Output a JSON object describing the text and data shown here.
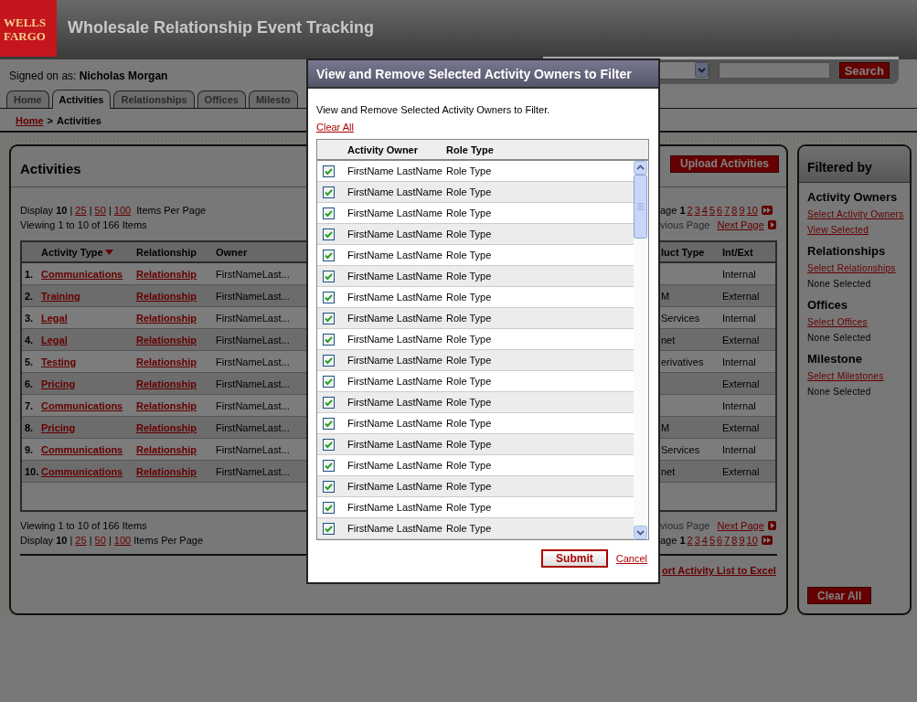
{
  "header": {
    "logo": "WELLS FARGO",
    "title": "Wholesale Relationship Event Tracking"
  },
  "search": {
    "button": "Search"
  },
  "user": {
    "label": "Signed on as:",
    "name": "Nicholas Morgan"
  },
  "tabs": [
    {
      "label": "Home",
      "selected": false
    },
    {
      "label": "Activities",
      "selected": true
    },
    {
      "label": "Relationships",
      "selected": false
    },
    {
      "label": "Offices",
      "selected": false
    },
    {
      "label": "Milesto",
      "selected": false
    }
  ],
  "breadcrumb": {
    "link": "Home",
    "separator": ">",
    "current": "Activities"
  },
  "activities": {
    "title": "Activities",
    "upload_button": "Upload Activities",
    "top_bar": {
      "display": {
        "label": "Display",
        "current": "10",
        "separator": "|",
        "options": [
          "25",
          "50",
          "100"
        ],
        "suffix": "Items Per Page"
      },
      "viewing": "Viewing 1 to 10 of 166 Items",
      "pager": {
        "label": "age",
        "current": "1",
        "pages": [
          "2",
          "3",
          "4",
          "5",
          "6",
          "7",
          "8",
          "9",
          "10"
        ],
        "previous": "vious Page",
        "next": "Next Page"
      }
    },
    "columns": [
      {
        "label": "Activity Type",
        "sorted": true
      },
      {
        "label": "Relationship",
        "sorted": false
      },
      {
        "label": "Owner",
        "sorted": false
      },
      {
        "label": "luct Type",
        "sorted": false
      },
      {
        "label": "Int/Ext",
        "sorted": false
      }
    ],
    "rows": [
      {
        "number": "1.",
        "activity_type": "Communications",
        "relationship": "Relationship",
        "owner": "FirstNameLast...",
        "int_ext": "Internal"
      },
      {
        "number": "2.",
        "activity_type": "Training",
        "relationship": "Relationship",
        "owner": "FirstNameLast...",
        "product_type": "M",
        "int_ext": "External"
      },
      {
        "number": "3.",
        "activity_type": "Legal",
        "relationship": "Relationship",
        "owner": "FirstNameLast...",
        "product_type": "Services",
        "int_ext": "Internal"
      },
      {
        "number": "4.",
        "activity_type": "Legal",
        "relationship": "Relationship",
        "owner": "FirstNameLast...",
        "product_type": "net",
        "int_ext": "External"
      },
      {
        "number": "5.",
        "activity_type": "Testing",
        "relationship": "Relationship",
        "owner": "FirstNameLast...",
        "product_type": "erivatives",
        "int_ext": "Internal"
      },
      {
        "number": "6.",
        "activity_type": "Pricing",
        "relationship": "Relationship",
        "owner": "FirstNameLast...",
        "int_ext": "External"
      },
      {
        "number": "7.",
        "activity_type": "Communications",
        "relationship": "Relationship",
        "owner": "FirstNameLast...",
        "int_ext": "Internal"
      },
      {
        "number": "8.",
        "activity_type": "Pricing",
        "relationship": "Relationship",
        "owner": "FirstNameLast...",
        "product_type": "M",
        "int_ext": "External"
      },
      {
        "number": "9.",
        "activity_type": "Communications",
        "relationship": "Relationship",
        "owner": "FirstNameLast...",
        "product_type": "Services",
        "int_ext": "Internal"
      },
      {
        "number": "10.",
        "activity_type": "Communications",
        "relationship": "Relationship",
        "owner": "FirstNameLast...",
        "product_type": "net",
        "int_ext": "External"
      }
    ],
    "bottom_bar": {
      "display": {
        "label": "Display",
        "current": "10",
        "separator": "|",
        "options": [
          "25",
          "50",
          "100"
        ],
        "suffix": "Items Per Page"
      },
      "viewing": "Viewing 1 to 10 of 166 Items",
      "pager": {
        "label": "age",
        "current": "1",
        "pages": [
          "2",
          "3",
          "4",
          "5",
          "6",
          "7",
          "8",
          "9",
          "10"
        ],
        "previous": "vious Page",
        "next": "Next Page"
      }
    },
    "export_link": "ort Activity List to Excel"
  },
  "filters": {
    "title": "Filtered by",
    "sections": [
      {
        "heading": "Activity Owners",
        "links": [
          "Select Activity Owners",
          "View Selected"
        ]
      },
      {
        "heading": "Relationships",
        "links": [
          "Select Relationships"
        ],
        "status": "None Selected"
      },
      {
        "heading": "Offices",
        "links": [
          "Select Offices"
        ],
        "status": "None Selected"
      },
      {
        "heading": "Milestone",
        "links": [
          "Select Milestones"
        ],
        "status": "None Selected"
      }
    ],
    "clear_button": "Clear All"
  },
  "dialog": {
    "title": "View and Remove Selected Activity Owners to Filter",
    "instructions": "View and Remove Selected Activity Owners to Filter.",
    "clear_link": "Clear All",
    "columns": [
      "Activity Owner",
      "Role Type"
    ],
    "owners": [
      {
        "name": "FirstName LastName",
        "role": "Role Type",
        "checked": true
      },
      {
        "name": "FirstName LastName",
        "role": "Role Type",
        "checked": true
      },
      {
        "name": "FirstName LastName",
        "role": "Role Type",
        "checked": true
      },
      {
        "name": "FirstName LastName",
        "role": "Role Type",
        "checked": true
      },
      {
        "name": "FirstName LastName",
        "role": "Role Type",
        "checked": true
      },
      {
        "name": "FirstName LastName",
        "role": "Role Type",
        "checked": true
      },
      {
        "name": "FirstName LastName",
        "role": "Role Type",
        "checked": true
      },
      {
        "name": "FirstName LastName",
        "role": "Role Type",
        "checked": true
      },
      {
        "name": "FirstName LastName",
        "role": "Role Type",
        "checked": true
      },
      {
        "name": "FirstName LastName",
        "role": "Role Type",
        "checked": true
      },
      {
        "name": "FirstName LastName",
        "role": "Role Type",
        "checked": true
      },
      {
        "name": "FirstName LastName",
        "role": "Role Type",
        "checked": true
      },
      {
        "name": "FirstName LastName",
        "role": "Role Type",
        "checked": true
      },
      {
        "name": "FirstName LastName",
        "role": "Role Type",
        "checked": true
      },
      {
        "name": "FirstName LastName",
        "role": "Role Type",
        "checked": true
      },
      {
        "name": "FirstName LastName",
        "role": "Role Type",
        "checked": true
      },
      {
        "name": "FirstName LastName",
        "role": "Role Type",
        "checked": true
      },
      {
        "name": "FirstName LastName",
        "role": "Role Type",
        "checked": true
      }
    ],
    "submit": "Submit",
    "cancel": "Cancel"
  }
}
